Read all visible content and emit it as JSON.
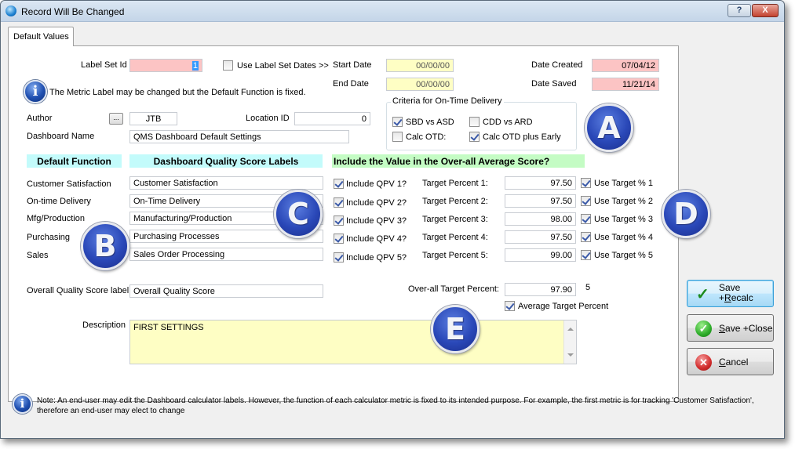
{
  "window": {
    "title": "Record Will Be Changed",
    "help_label": "?",
    "close_label": "X"
  },
  "tabs": [
    {
      "label": "Default Values",
      "active": true
    }
  ],
  "label_set": {
    "label": "Label Set Id",
    "value": "1",
    "use_dates_label": "Use Label Set Dates >>",
    "use_dates_checked": false
  },
  "dates": {
    "start_label": "Start Date",
    "start_value": "00/00/00",
    "end_label": "End Date",
    "end_value": "00/00/00",
    "created_label": "Date Created",
    "created_value": "07/04/12",
    "saved_label": "Date Saved",
    "saved_value": "11/21/14"
  },
  "info_message": "The Metric Label may be changed but the Default Function is fixed.",
  "author": {
    "label": "Author",
    "lookup_button": "...",
    "value": "JTB"
  },
  "location": {
    "label": "Location ID",
    "value": "0"
  },
  "dashboard_name": {
    "label": "Dashboard Name",
    "value": "QMS Dashboard Default Settings"
  },
  "otd_criteria": {
    "title": "Criteria for On-Time Delivery",
    "options": [
      {
        "label": "SBD vs ASD",
        "checked": true
      },
      {
        "label": "CDD vs ARD",
        "checked": false
      },
      {
        "label": "Calc OTD:",
        "checked": false
      },
      {
        "label": "Calc OTD plus Early",
        "checked": true
      }
    ]
  },
  "headers": {
    "default_function": "Default Function",
    "score_labels": "Dashboard Quality Score Labels",
    "include_value": "Include the Value in the Over-all Average Score?"
  },
  "metrics": [
    {
      "function": "Customer Satisfaction",
      "label": "Customer Satisfaction",
      "include_label": "Include QPV 1?",
      "include": true,
      "target_label": "Target Percent 1:",
      "target": "97.50",
      "use_label": "Use Target % 1",
      "use": true
    },
    {
      "function": "On-time Delivery",
      "label": "On-Time Delivery",
      "include_label": "Include QPV 2?",
      "include": true,
      "target_label": "Target Percent 2:",
      "target": "97.50",
      "use_label": "Use Target % 2",
      "use": true
    },
    {
      "function": "Mfg/Production",
      "label": "Manufacturing/Production",
      "include_label": "Include QPV 3?",
      "include": true,
      "target_label": "Target Percent 3:",
      "target": "98.00",
      "use_label": "Use Target % 3",
      "use": true
    },
    {
      "function": "Purchasing",
      "label": "Purchasing Processes",
      "include_label": "Include QPV 4?",
      "include": true,
      "target_label": "Target Percent 4:",
      "target": "97.50",
      "use_label": "Use Target % 4",
      "use": true
    },
    {
      "function": "Sales",
      "label": "Sales Order Processing",
      "include_label": "Include QPV 5?",
      "include": true,
      "target_label": "Target Percent 5:",
      "target": "99.00",
      "use_label": "Use Target % 5",
      "use": true
    }
  ],
  "overall": {
    "label": "Overall Quality Score label",
    "value": "Overall Quality Score",
    "target_label": "Over-all Target Percent:",
    "target_value": "97.90",
    "count": "5",
    "average_label": "Average Target Percent",
    "average_checked": true
  },
  "description": {
    "label": "Description",
    "value": "FIRST SETTINGS"
  },
  "callouts": [
    "A",
    "B",
    "C",
    "D",
    "E"
  ],
  "buttons": {
    "save_recalc_line1": "Save",
    "save_recalc_prefix": "+",
    "save_recalc_accel": "R",
    "save_recalc_rest": "ecalc",
    "save_close_accel": "S",
    "save_close_rest": "ave +Close",
    "cancel_accel": "C",
    "cancel_rest": "ancel"
  },
  "footer_note": "Note: An end-user may edit the Dashboard calculator labels. However, the function of each calculator metric is fixed to its intended purpose. For example, the first metric is for tracking 'Customer Satisfaction', therefore an end-user may elect to change"
}
